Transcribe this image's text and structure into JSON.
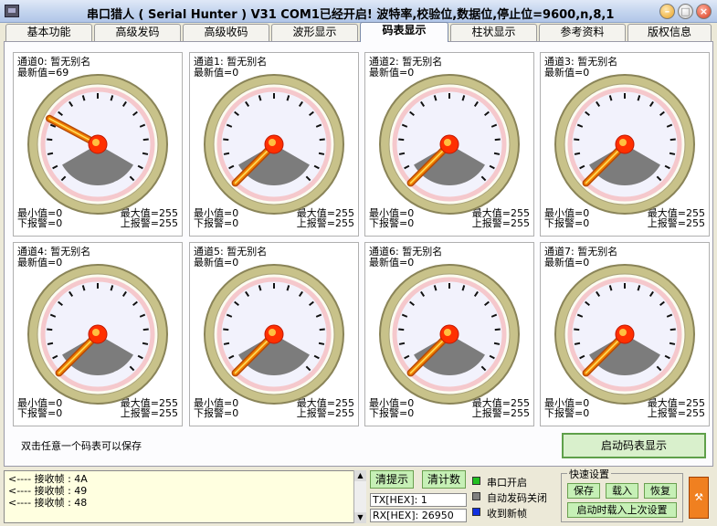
{
  "window": {
    "title": "串口猎人 ( Serial Hunter ) V31    COM1已经开启!  波特率,校验位,数据位,停止位=9600,n,8,1",
    "min_label": "–",
    "max_label": "□",
    "close_label": "×"
  },
  "tabs": [
    {
      "label": "基本功能",
      "active": false
    },
    {
      "label": "高级发码",
      "active": false
    },
    {
      "label": "高级收码",
      "active": false
    },
    {
      "label": "波形显示",
      "active": false
    },
    {
      "label": "码表显示",
      "active": true
    },
    {
      "label": "柱状显示",
      "active": false
    },
    {
      "label": "参考资料",
      "active": false
    },
    {
      "label": "版权信息",
      "active": false
    }
  ],
  "gauges": [
    {
      "channel": "通道0: 暂无别名",
      "latest": "最新值=69",
      "value": 69,
      "min": "最小值=0",
      "max": "最大值=255",
      "low_alarm": "下报警=0",
      "high_alarm": "上报警=255"
    },
    {
      "channel": "通道1: 暂无别名",
      "latest": "最新值=0",
      "value": 0,
      "min": "最小值=0",
      "max": "最大值=255",
      "low_alarm": "下报警=0",
      "high_alarm": "上报警=255"
    },
    {
      "channel": "通道2: 暂无别名",
      "latest": "最新值=0",
      "value": 0,
      "min": "最小值=0",
      "max": "最大值=255",
      "low_alarm": "下报警=0",
      "high_alarm": "上报警=255"
    },
    {
      "channel": "通道3: 暂无别名",
      "latest": "最新值=0",
      "value": 0,
      "min": "最小值=0",
      "max": "最大值=255",
      "low_alarm": "下报警=0",
      "high_alarm": "上报警=255"
    },
    {
      "channel": "通道4: 暂无别名",
      "latest": "最新值=0",
      "value": 0,
      "min": "最小值=0",
      "max": "最大值=255",
      "low_alarm": "下报警=0",
      "high_alarm": "上报警=255"
    },
    {
      "channel": "通道5: 暂无别名",
      "latest": "最新值=0",
      "value": 0,
      "min": "最小值=0",
      "max": "最大值=255",
      "low_alarm": "下报警=0",
      "high_alarm": "上报警=255"
    },
    {
      "channel": "通道6: 暂无别名",
      "latest": "最新值=0",
      "value": 0,
      "min": "最小值=0",
      "max": "最大值=255",
      "low_alarm": "下报警=0",
      "high_alarm": "上报警=255"
    },
    {
      "channel": "通道7: 暂无别名",
      "latest": "最新值=0",
      "value": 0,
      "min": "最小值=0",
      "max": "最大值=255",
      "low_alarm": "下报警=0",
      "high_alarm": "上报警=255"
    }
  ],
  "hint": "双击任意一个码表可以保存",
  "start_button": "启动码表显示",
  "log_lines": [
    "<---- 接收帧 : 4A",
    "<---- 接收帧 : 49",
    "<---- 接收帧 : 48"
  ],
  "clear_hint_button": "清提示",
  "clear_count_button": "清计数",
  "tx": "TX[HEX]: 1",
  "rx": "RX[HEX]: 26950",
  "status": [
    {
      "label": "串口开启",
      "color": "#22c022"
    },
    {
      "label": "自动发码关闭",
      "color": "#808080"
    },
    {
      "label": "收到新帧",
      "color": "#1030e0"
    }
  ],
  "quick": {
    "title": "快速设置",
    "save": "保存",
    "load": "载入",
    "restore": "恢复",
    "startup_load": "启动时载入上次设置"
  },
  "colors": {
    "needle": "#f08000",
    "pivot": "#ff3000",
    "bezel": "#c8c28a",
    "face": "#f2f2fc"
  }
}
